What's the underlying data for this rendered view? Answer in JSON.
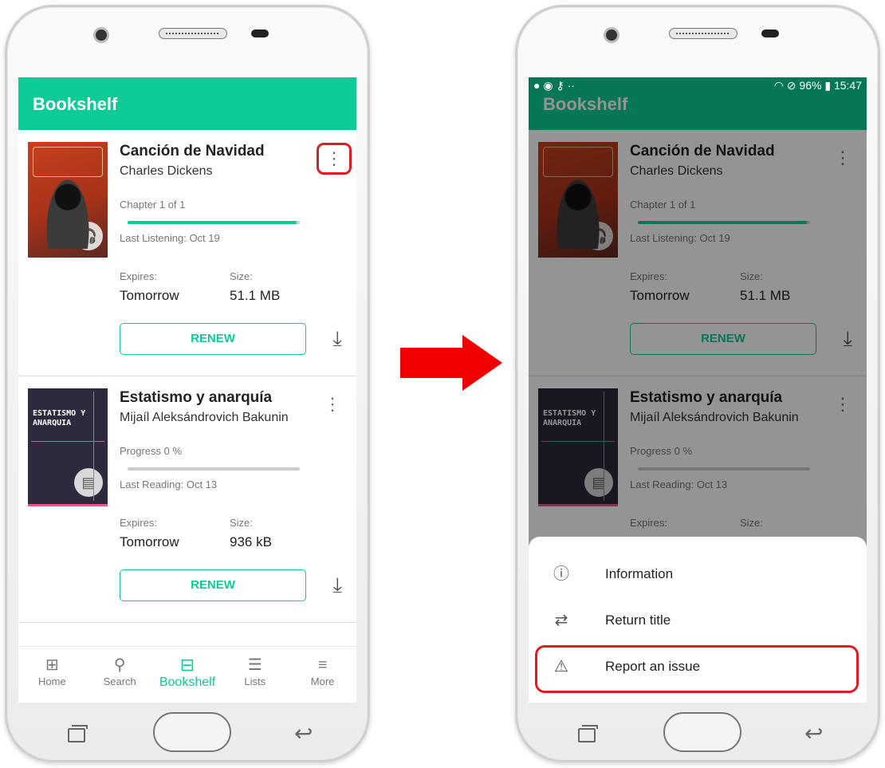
{
  "before": {
    "app_title": "Bookshelf",
    "books": [
      {
        "title": "Canción de Navidad",
        "author": "Charles Dickens",
        "progress_label": "Chapter 1 of 1",
        "progress": 0.98,
        "last_activity": "Last Listening: Oct 19",
        "expires_label": "Expires:",
        "expires_value": "Tomorrow",
        "size_label": "Size:",
        "size_value": "51.1 MB",
        "renew_label": "RENEW",
        "format_icon": "headphones-icon"
      },
      {
        "title": "Estatismo y anarquía",
        "author": "Mijaíl Aleksándrovich Bakunin",
        "cover_title": "ESTATISMO Y ANARQUIA",
        "progress_label": "Progress 0 %",
        "progress": 0,
        "last_activity": "Last Reading: Oct 13",
        "expires_label": "Expires:",
        "expires_value": "Tomorrow",
        "size_label": "Size:",
        "size_value": "936 kB",
        "renew_label": "RENEW",
        "format_icon": "ebook-icon"
      }
    ],
    "tabs": [
      {
        "label": "Home",
        "icon": "grid-icon"
      },
      {
        "label": "Search",
        "icon": "search-icon"
      },
      {
        "label": "Bookshelf",
        "icon": "bookshelf-icon",
        "active": true
      },
      {
        "label": "Lists",
        "icon": "list-heart-icon"
      },
      {
        "label": "More",
        "icon": "menu-icon"
      }
    ]
  },
  "after": {
    "status": {
      "battery": "96%",
      "time": "15:47"
    },
    "menu_items": [
      {
        "label": "Information",
        "icon": "info-icon"
      },
      {
        "label": "Return title",
        "icon": "swap-arrows-icon"
      },
      {
        "label": "Report an issue",
        "icon": "report-icon",
        "highlighted": true
      }
    ]
  },
  "colors": {
    "accent": "#0dcb96",
    "accent_dim": "#0a6e52",
    "highlight": "#e01b22",
    "arrow": "#f20000"
  }
}
